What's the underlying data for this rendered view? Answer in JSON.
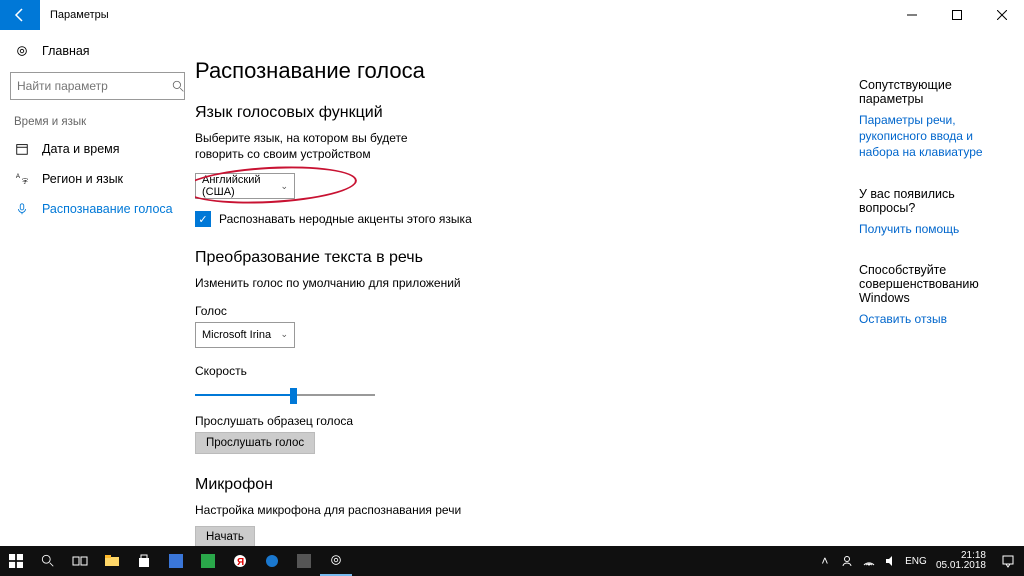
{
  "titlebar": {
    "app_title": "Параметры"
  },
  "sidebar": {
    "home_label": "Главная",
    "search_placeholder": "Найти параметр",
    "group_label": "Время и язык",
    "items": [
      {
        "label": "Дата и время"
      },
      {
        "label": "Регион и язык"
      },
      {
        "label": "Распознавание голоса"
      }
    ]
  },
  "main": {
    "page_title": "Распознавание голоса",
    "speech_lang": {
      "heading": "Язык голосовых функций",
      "desc": "Выберите язык, на котором вы будете говорить со своим устройством",
      "selected": "Английский (США)",
      "checkbox_label": "Распознавать неродные акценты этого языка"
    },
    "tts": {
      "heading": "Преобразование текста в речь",
      "desc": "Изменить голос по умолчанию для приложений",
      "voice_label": "Голос",
      "voice_selected": "Microsoft Irina",
      "speed_label": "Скорость",
      "preview_label": "Прослушать образец голоса",
      "preview_btn": "Прослушать голос"
    },
    "mic": {
      "heading": "Микрофон",
      "desc": "Настройка микрофона для распознавания речи",
      "start_btn": "Начать"
    }
  },
  "rail": {
    "related_heading": "Сопутствующие параметры",
    "related_link": "Параметры речи, рукописного ввода и набора на клавиатуре",
    "questions_heading": "У вас появились вопросы?",
    "help_link": "Получить помощь",
    "improve_heading": "Способствуйте совершенствованию Windows",
    "feedback_link": "Оставить отзыв"
  },
  "taskbar": {
    "lang": "ENG",
    "time": "21:18",
    "date": "05.01.2018"
  }
}
